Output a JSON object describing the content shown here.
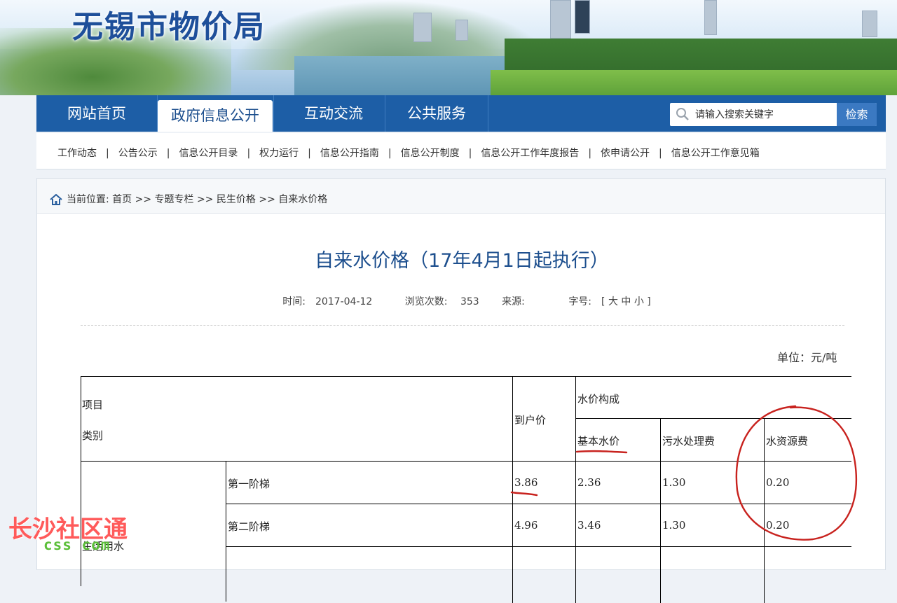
{
  "site": {
    "logo_text": "无锡市物价局"
  },
  "nav": {
    "items": [
      {
        "label": "网站首页",
        "active": false
      },
      {
        "label": "政府信息公开",
        "active": true
      },
      {
        "label": "互动交流",
        "active": false
      },
      {
        "label": "公共服务",
        "active": false
      }
    ],
    "search_placeholder": "请输入搜索关键字",
    "search_button": "检索"
  },
  "subnav": {
    "items": [
      "工作动态",
      "公告公示",
      "信息公开目录",
      "权力运行",
      "信息公开指南",
      "信息公开制度",
      "信息公开工作年度报告",
      "依申请公开",
      "信息公开工作意见箱"
    ],
    "divider": "|"
  },
  "breadcrumb": {
    "prefix": "当前位置:",
    "path": "首页 >> 专题专栏 >> 民生价格 >> 自来水价格"
  },
  "article": {
    "title": "自来水价格（17年4月1日起执行）",
    "time_label": "时间:",
    "time_value": "2017-04-12",
    "views_label": "浏览次数:",
    "views_value": "353",
    "source_label": "来源:",
    "font_label": "字号:",
    "font_options": "[ 大 中 小 ]",
    "unit": "单位：元/吨"
  },
  "table": {
    "head_item": "项目",
    "head_category": "类别",
    "head_total": "到户价",
    "head_composition": "水价构成",
    "head_basic": "基本水价",
    "head_sewage": "污水处理费",
    "head_resource": "水资源费",
    "group_label": "生活用水",
    "rows": [
      {
        "tier": "第一阶梯",
        "total": "3.86",
        "basic": "2.36",
        "sewage": "1.30",
        "resource": "0.20"
      },
      {
        "tier": "第二阶梯",
        "total": "4.96",
        "basic": "3.46",
        "sewage": "1.30",
        "resource": "0.20"
      }
    ]
  },
  "watermark": {
    "main": "长沙社区通",
    "sub": "www.csqt.com",
    "visible_sub": "css      com"
  },
  "colors": {
    "nav_blue": "#1d5ea6",
    "title_blue": "#1d4f8e",
    "annotation_red": "#c8221e"
  }
}
